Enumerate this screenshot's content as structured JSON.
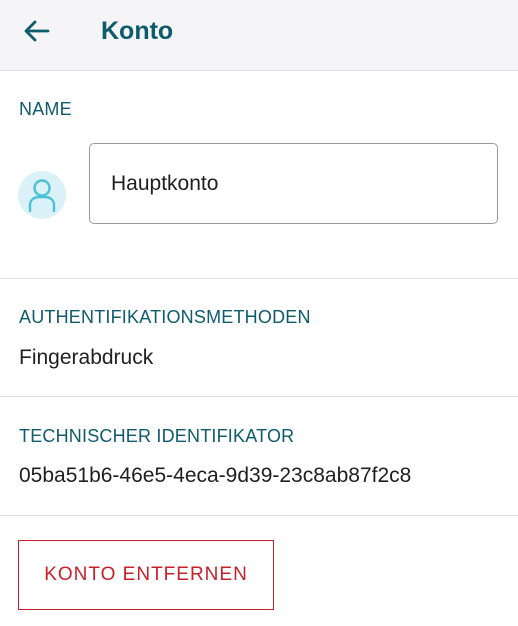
{
  "header": {
    "title": "Konto",
    "back_icon": "arrow-left-icon"
  },
  "name_section": {
    "label": "NAME",
    "avatar_icon": "user-avatar-icon",
    "input_value": "Hauptkonto"
  },
  "auth_section": {
    "label": "AUTHENTIFIKATIONSMETHODEN",
    "value": "Fingerabdruck"
  },
  "tech_id_section": {
    "label": "TECHNISCHER IDENTIFIKATOR",
    "value": "05ba51b6-46e5-4eca-9d39-23c8ab87f2c8"
  },
  "actions": {
    "remove_label": "KONTO ENTFERNEN"
  },
  "colors": {
    "accent": "#0e5b6b",
    "danger": "#c8202a",
    "avatar_bg": "#d9f1f7",
    "avatar_fg": "#4cc0d6"
  }
}
